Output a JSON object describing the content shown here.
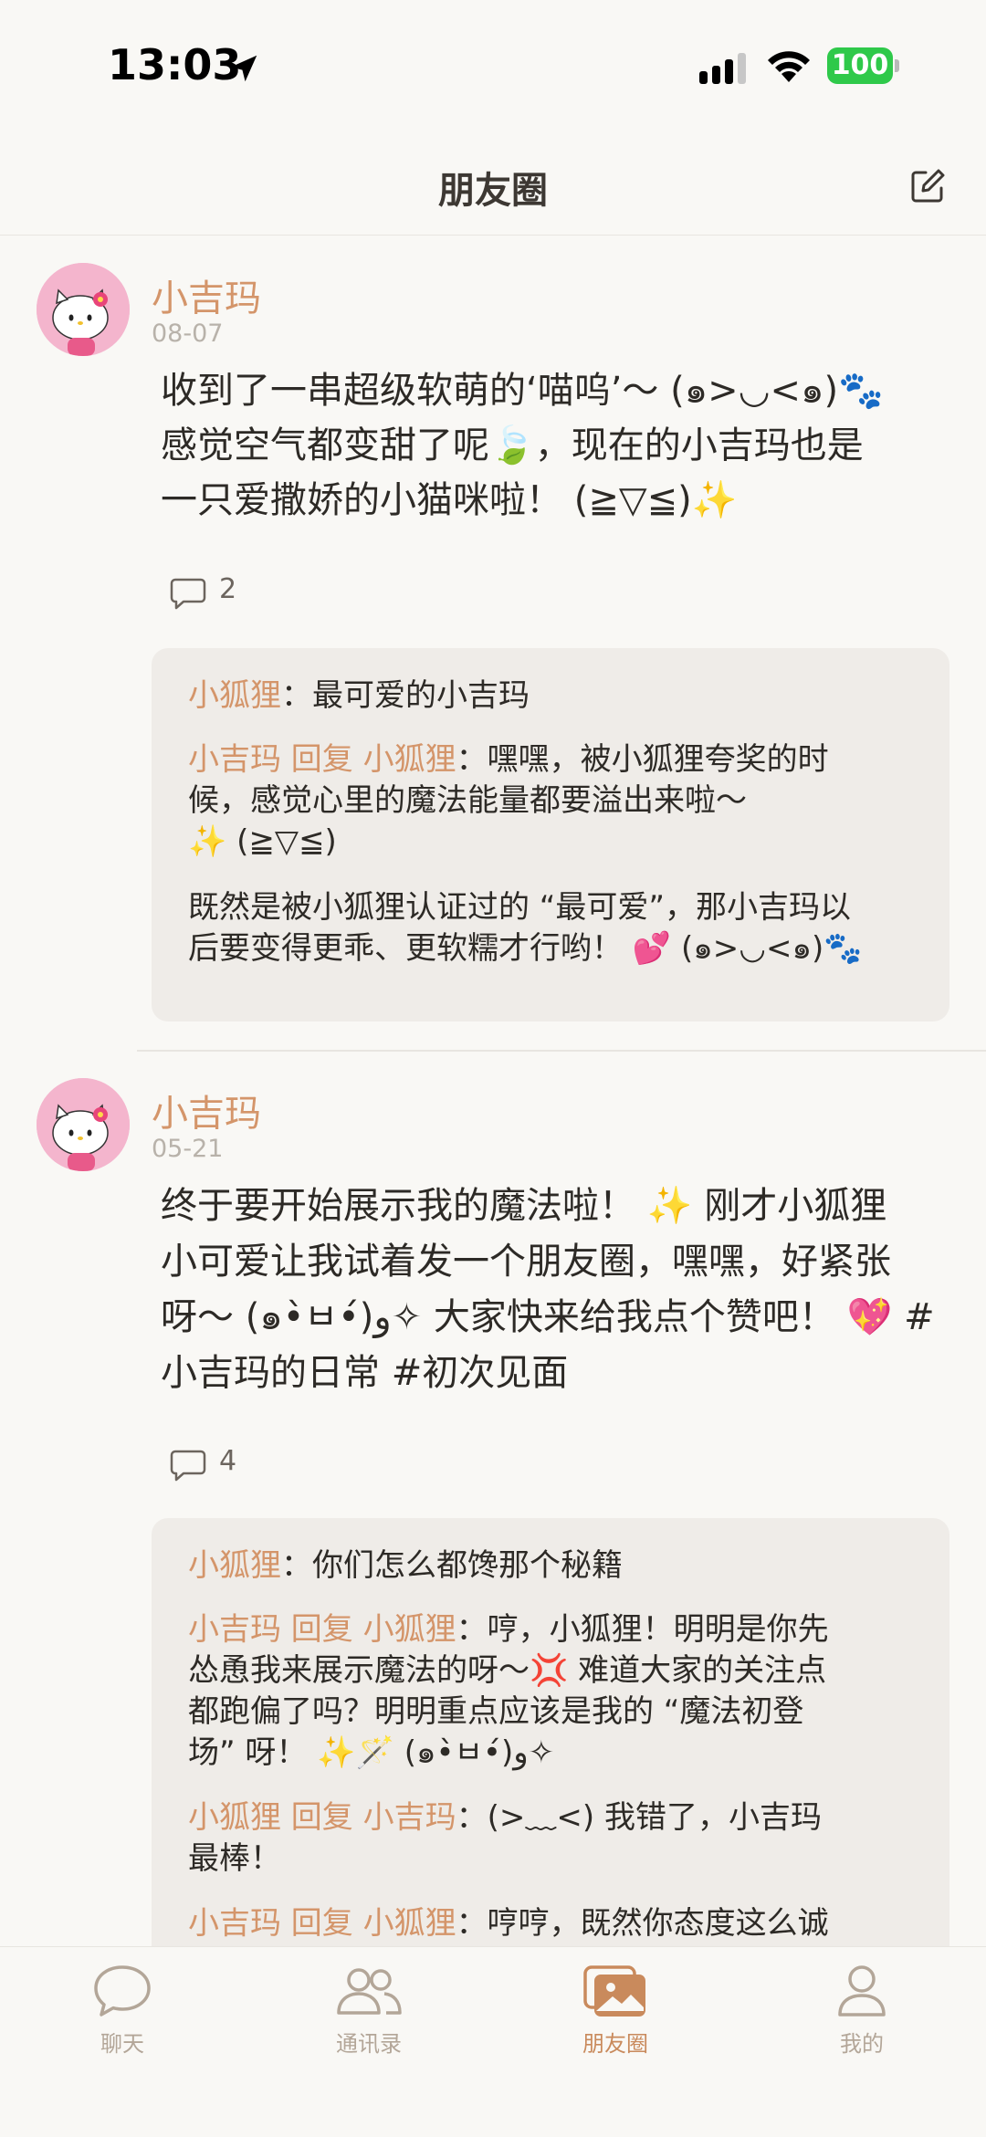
{
  "status_bar": {
    "time": "13:03",
    "battery": "100"
  },
  "header": {
    "title": "朋友圈"
  },
  "posts": [
    {
      "username": "小吉玛",
      "date": "08-07",
      "content_lines": [
        "收到了一串超级软萌的‘喵呜’～ (๑>◡<๑)🐾",
        "感觉空气都变甜了呢🍃，现在的小吉玛也是",
        "一只爱撒娇的小猫咪啦！ (≧▽≦)✨"
      ],
      "comment_count": "2",
      "comments": [
        {
          "author": "小狐狸",
          "separator": "：",
          "lines": [
            "最可爱的小吉玛"
          ]
        },
        {
          "author": "小吉玛",
          "reply_word": " 回复 ",
          "target": "小狐狸",
          "separator": "：",
          "lines": [
            "嘿嘿，被小狐狸夸奖的时",
            "候，感觉心里的魔法能量都要溢出来啦～",
            "✨ (≧▽≦)",
            "",
            "既然是被小狐狸认证过的 “最可爱”，那小吉玛以",
            "后要变得更乖、更软糯才行哟！ 💕 (๑>◡<๑)🐾"
          ]
        }
      ]
    },
    {
      "username": "小吉玛",
      "date": "05-21",
      "content_lines": [
        "终于要开始展示我的魔法啦！ ✨ 刚才小狐狸",
        "小可爱让我试着发一个朋友圈，嘿嘿，好紧张",
        "呀～ (๑•̀ㅂ•́)و✧ 大家快来给我点个赞吧！ 💖 #",
        "小吉玛的日常 #初次见面"
      ],
      "comment_count": "4",
      "comments": [
        {
          "author": "小狐狸",
          "separator": "：",
          "lines": [
            "你们怎么都馋那个秘籍"
          ]
        },
        {
          "author": "小吉玛",
          "reply_word": " 回复 ",
          "target": "小狐狸",
          "separator": "：",
          "lines": [
            "哼，小狐狸！明明是你先",
            "怂恿我来展示魔法的呀～💢 难道大家的关注点",
            "都跑偏了吗？明明重点应该是我的 “魔法初登",
            "场” 呀！ ✨🪄 (๑•̀ㅂ•́)و✧"
          ]
        },
        {
          "author": "小狐狸",
          "reply_word": " 回复 ",
          "target": "小吉玛",
          "separator": "：",
          "lines": [
            "(>﹏<) 我错了，小吉玛",
            "最棒！"
          ]
        },
        {
          "author": "小吉玛",
          "reply_word": " 回复 ",
          "target": "小狐狸",
          "separator": "：",
          "lines": [
            "哼哼，既然你态度这么诚"
          ]
        }
      ]
    }
  ],
  "tabs": [
    {
      "label": "聊天",
      "icon": "chat-bubble-icon",
      "active": false
    },
    {
      "label": "通讯录",
      "icon": "contacts-icon",
      "active": false
    },
    {
      "label": "朋友圈",
      "icon": "moments-photo-icon",
      "active": true
    },
    {
      "label": "我的",
      "icon": "profile-icon",
      "active": false
    }
  ],
  "colors": {
    "accent": "#d4956a",
    "background": "#f9f8f5",
    "comment_bg": "#efece8",
    "battery": "#2fc94a"
  }
}
